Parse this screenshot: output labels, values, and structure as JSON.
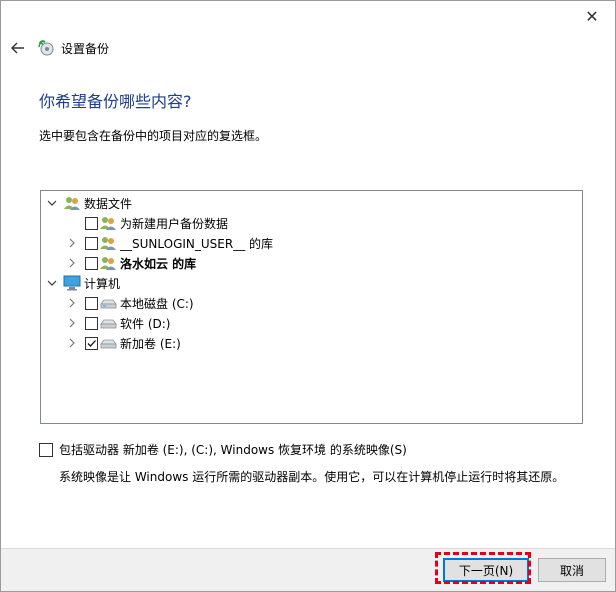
{
  "window": {
    "title": "设置备份",
    "close_glyph": "✕"
  },
  "heading": "你希望备份哪些内容?",
  "instruction": "选中要包含在备份中的项目对应的复选框。",
  "tree": {
    "data_files": {
      "label": "数据文件",
      "children": [
        {
          "label": "为新建用户备份数据",
          "checked": false
        },
        {
          "label": "__SUNLOGIN_USER__ 的库",
          "checked": false
        },
        {
          "label": "洛水如云 的库",
          "checked": false
        }
      ]
    },
    "computer": {
      "label": "计算机",
      "children": [
        {
          "label": "本地磁盘 (C:)",
          "checked": false
        },
        {
          "label": "软件 (D:)",
          "checked": false
        },
        {
          "label": "新加卷 (E:)",
          "checked": true
        }
      ]
    }
  },
  "system_image": {
    "label": "包括驱动器 新加卷 (E:), (C:), Windows 恢复环境 的系统映像(S)",
    "checked": false,
    "note": "系统映像是让 Windows 运行所需的驱动器副本。使用它，可以在计算机停止运行时将其还原。"
  },
  "buttons": {
    "next": "下一页(N)",
    "cancel": "取消"
  },
  "colors": {
    "heading": "#1e3d8f",
    "highlight": "#e0001a",
    "default_button_border": "#0078d7"
  }
}
